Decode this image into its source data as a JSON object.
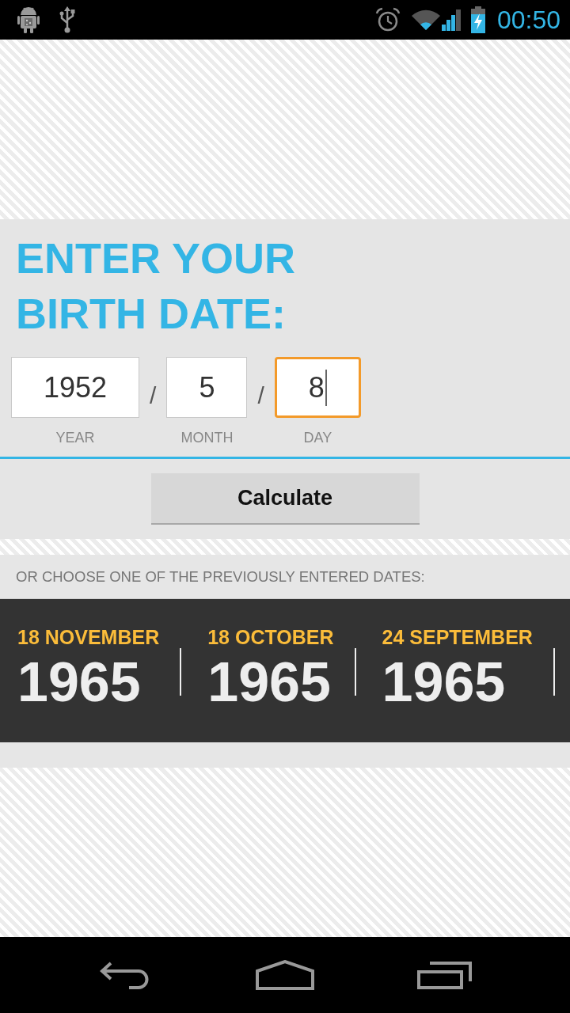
{
  "status_bar": {
    "time": "00:50"
  },
  "form": {
    "title": "ENTER YOUR BIRTH DATE:",
    "date_fields": [
      {
        "kind": "field",
        "value": "1952",
        "label": "YEAR",
        "focused": false
      },
      {
        "kind": "separator",
        "text": "/"
      },
      {
        "kind": "field",
        "value": "5",
        "label": "MONTH",
        "focused": false
      },
      {
        "kind": "separator",
        "text": "/"
      },
      {
        "kind": "field",
        "value": "8",
        "label": "DAY",
        "focused": true
      }
    ],
    "button": "Calculate"
  },
  "history": {
    "heading": "OR CHOOSE ONE OF THE PREVIOUSLY ENTERED DATES:",
    "dates": [
      {
        "day_month": "18 NOVEMBER",
        "year": "1965"
      },
      {
        "day_month": "18 OCTOBER",
        "year": "1965"
      },
      {
        "day_month": "24 SEPTEMBER",
        "year": "1965"
      }
    ]
  }
}
